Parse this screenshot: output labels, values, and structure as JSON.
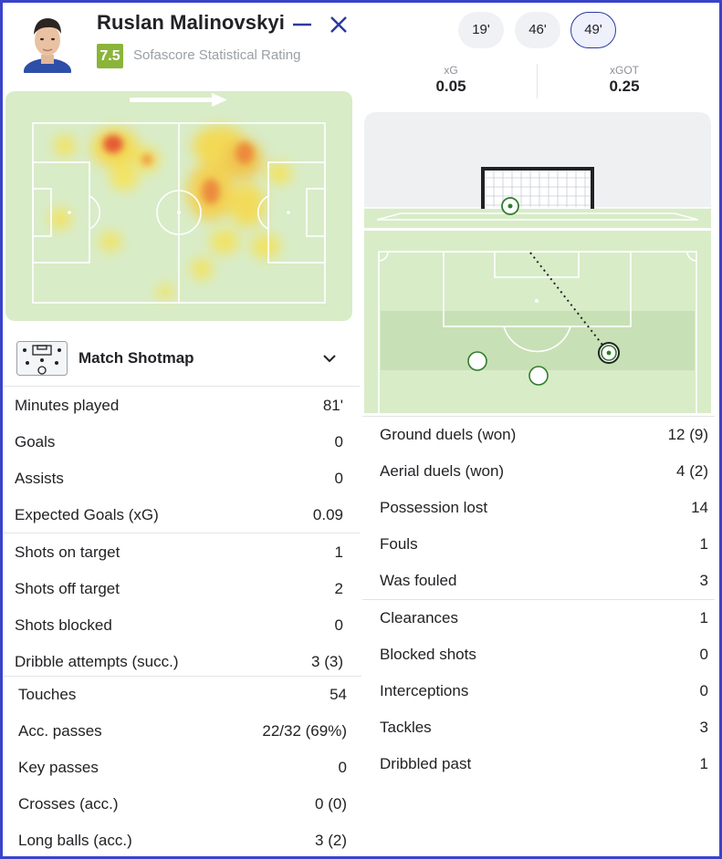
{
  "player": {
    "name": "Ruslan Malinovskyi",
    "rating": "7.5",
    "rating_label": "Sofascore Statistical Rating",
    "rating_color": "#8bb43a"
  },
  "header_icons": [
    "minimize-icon",
    "close-icon"
  ],
  "shotmap": {
    "title": "Match Shotmap",
    "minutes": [
      "19'",
      "46'",
      "49'"
    ],
    "selected_minute": "49'",
    "xg_label": "xG",
    "xg_value": "0.05",
    "xgot_label": "xGOT",
    "xgot_value": "0.25"
  },
  "left_stats": [
    [
      {
        "label": "Minutes played",
        "value": "81'"
      },
      {
        "label": "Goals",
        "value": "0"
      },
      {
        "label": "Assists",
        "value": "0"
      },
      {
        "label": "Expected Goals (xG)",
        "value": "0.09"
      }
    ],
    [
      {
        "label": "Shots on target",
        "value": "1"
      },
      {
        "label": "Shots off target",
        "value": "2"
      },
      {
        "label": "Shots blocked",
        "value": "0"
      },
      {
        "label": "Dribble attempts (succ.)",
        "value": "3 (3)"
      }
    ],
    [
      {
        "label": "Touches",
        "value": "54"
      },
      {
        "label": "Acc. passes",
        "value": "22/32 (69%)"
      },
      {
        "label": "Key passes",
        "value": "0"
      },
      {
        "label": "Crosses (acc.)",
        "value": "0 (0)"
      },
      {
        "label": "Long balls (acc.)",
        "value": "3 (2)"
      }
    ]
  ],
  "right_stats": [
    [
      {
        "label": "Ground duels (won)",
        "value": "12 (9)"
      },
      {
        "label": "Aerial duels (won)",
        "value": "4 (2)"
      },
      {
        "label": "Possession lost",
        "value": "14"
      },
      {
        "label": "Fouls",
        "value": "1"
      },
      {
        "label": "Was fouled",
        "value": "3"
      }
    ],
    [
      {
        "label": "Clearances",
        "value": "1"
      },
      {
        "label": "Blocked shots",
        "value": "0"
      },
      {
        "label": "Interceptions",
        "value": "0"
      },
      {
        "label": "Tackles",
        "value": "3"
      },
      {
        "label": "Dribbled past",
        "value": "1"
      }
    ]
  ],
  "colors": {
    "accent": "#2b3a9e",
    "frame": "#3a43c9",
    "pitch": "#d8ecc8",
    "shot_outline": "#2f7d2a"
  }
}
